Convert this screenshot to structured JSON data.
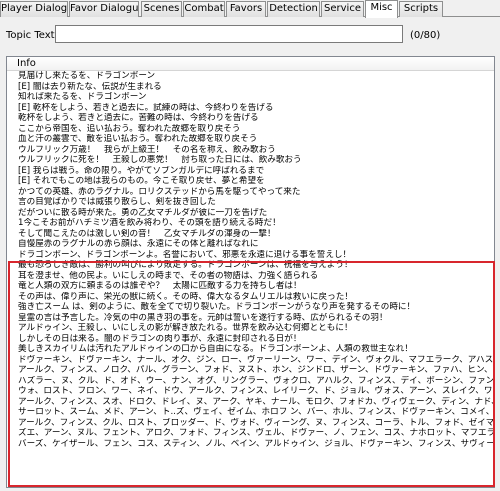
{
  "tabs": [
    {
      "label": "Player Dialogue"
    },
    {
      "label": "Favor Dialogue"
    },
    {
      "label": "Scenes"
    },
    {
      "label": "Combat"
    },
    {
      "label": "Favors"
    },
    {
      "label": "Detection"
    },
    {
      "label": "Service"
    },
    {
      "label": "Misc"
    },
    {
      "label": "Scripts"
    }
  ],
  "active_tab": "Misc",
  "topic": {
    "label": "Topic Text",
    "value": "",
    "counter": "(0/80)"
  },
  "list": {
    "header": "Info",
    "rows": [
      "見届けし来たるを、ドラゴンボーン",
      "[E] 闇は去り新たな、伝説が生まれる",
      "知れば来たるを、ドラゴンボーン",
      "[E] 乾杯をしよう、若きと過去に。試練の時は、今終わりを告げる",
      "乾杯をしよう、若きと過去に。苦難の時は、今終わりを告げる",
      "ここから帝国を、追い払おう。奪われた故郷を取り戻そう",
      "血と汗の叢雲で、敵を追い払おう。奪われた故郷を取り戻そう",
      "ウルフリック万歳！　我らが上級王！　その名を称え、飲み歌おう",
      "ウルフリックに死を！　王殺しの悪党！　討ち取った日には、飲み歌おう",
      "[E] 我らは戦う。命の限り。やがてソブンガルデに呼ばれるまで",
      "[E] それでもこの地は我らのもの。今こそ取り戻せ、夢と希望を",
      "かつての英雄、赤のラグナル。ロリクステッドから馬を駆ってやって来た",
      "言の目覚ばかりでは威張り散らし、剣を抜き回した",
      "だがついに散る時が来た。勇の乙女マチルダが彼に一刀を告げた",
      "1今こそお前がハチミツ酒を飲み将わり、その頭を語り続える時だ！",
      "そして聞こえたのは激しい剣の音！　乙女マチルダの渾身の一撃！",
      "自慢屋赤のラグナルの赤ら顔は、永遠にその体と離ればなれに",
      "ドラゴンボーン、ドラゴンボーンよ。名誉において、邪悪を永遠に退ける事を誓えし！",
      "最も恐ろしき敵は、勝利の叫びにより敗走する。ドラゴンボーンは、祝福を与えよう！",
      "耳を澄ませ、他の民よ。いにしえの時まで、その者の物語は、力強く語られる",
      "竜と人類の双方に頼まるのは誰ぞや？　太陽に匹敵する力を持ちし者は！",
      "その声は、偉り声に、栄光の獣に続く。その時、偉大なるタムリエルは救いに戻った！",
      "強き亡スーム は、剣のように、敵を全てで切り裂いた。ドラゴンボーンがうなり声を発するその時に！",
      "皇霊の言は予言した。冷気の中の黒き羽の事を。元帥は誓いを遂行する時、広がられるその羽！",
      "アルドゥイン、王殺し、いにしえの影が解き放たれる。世界を飲み込む何郷とともに！",
      "しかしその日は来る。闇のドラゴンの肉り事が、永遠に封印される日が！",
      "美しきスカイリムは汚れたアルドゥインの口から自由になる。ドラゴンボーンよ、人類の救世主なれ！",
      "ドヴァーキン、ドヴァーキン、ナール、オク、ジン、ロー、ヴァーリーン、ワー、デイン、ヴォクル、マフエラーク、アハスト、ヴァール",
      "アールク、フィンス、ノロク、パル、グラーン、フォド、ヌスト、ホン、ジンドロ、ザーン、ドヴァーキン、ファハ、ヒン、コガーン、ム、ドラール！",
      "ハズラー、ヌ、クル、ド、オド、ウー、ナン、オグ、リングラー、ヴォクロ、アハルク、フィンス、デイ、ボーシン、ファン、ド、フィンス、ジェイン！",
      "ウォ、ロスト、フロン、ワー、ネイ、ドウ、アールク、フィンス、レイリーク、ド、ジョル、ヴォス、アーン、スレイク、ワー、ロエト、ファール、クレイン！",
      "アールク、フィンス、スオ、ドロク、ドレイ、ヌ、アーク、ヤキ、ナール、モロク、フォドカ、ヴィヴェーク、ディン、ナド、ダーマーン、ヌード、ナラン！",
      "サーロット、スーム、メド、アーン、ト..ズ、ヴェイ、ゼイム、ホロフ ン、バー、ホル、フィンス、ドヴァーキン、コメイ、オク、リング！",
      "アールク、フィンス、クル、ロスト、ブロッダー、ド、ヴォド、ヴィーング、ヌ、フィンス、コーラ、トル、フォド、ゼイマー、ウィン、ダイン、メイズ、ファンデイン！",
      "ズエ、アーン、ヌル、フェント、アロク、フォド、フィンス、ヴェル、ドヴァー、ノ、フェン、コス、ナホロット、マフエラーク、アールク、ルズ！",
      "バーズ、ケイザール、フェン、コス、スティン、ノル、ベイン、アルドゥイン、ジョル、ドヴァーキン、フィンス、サヴィーク、ド、マズ！"
    ]
  }
}
